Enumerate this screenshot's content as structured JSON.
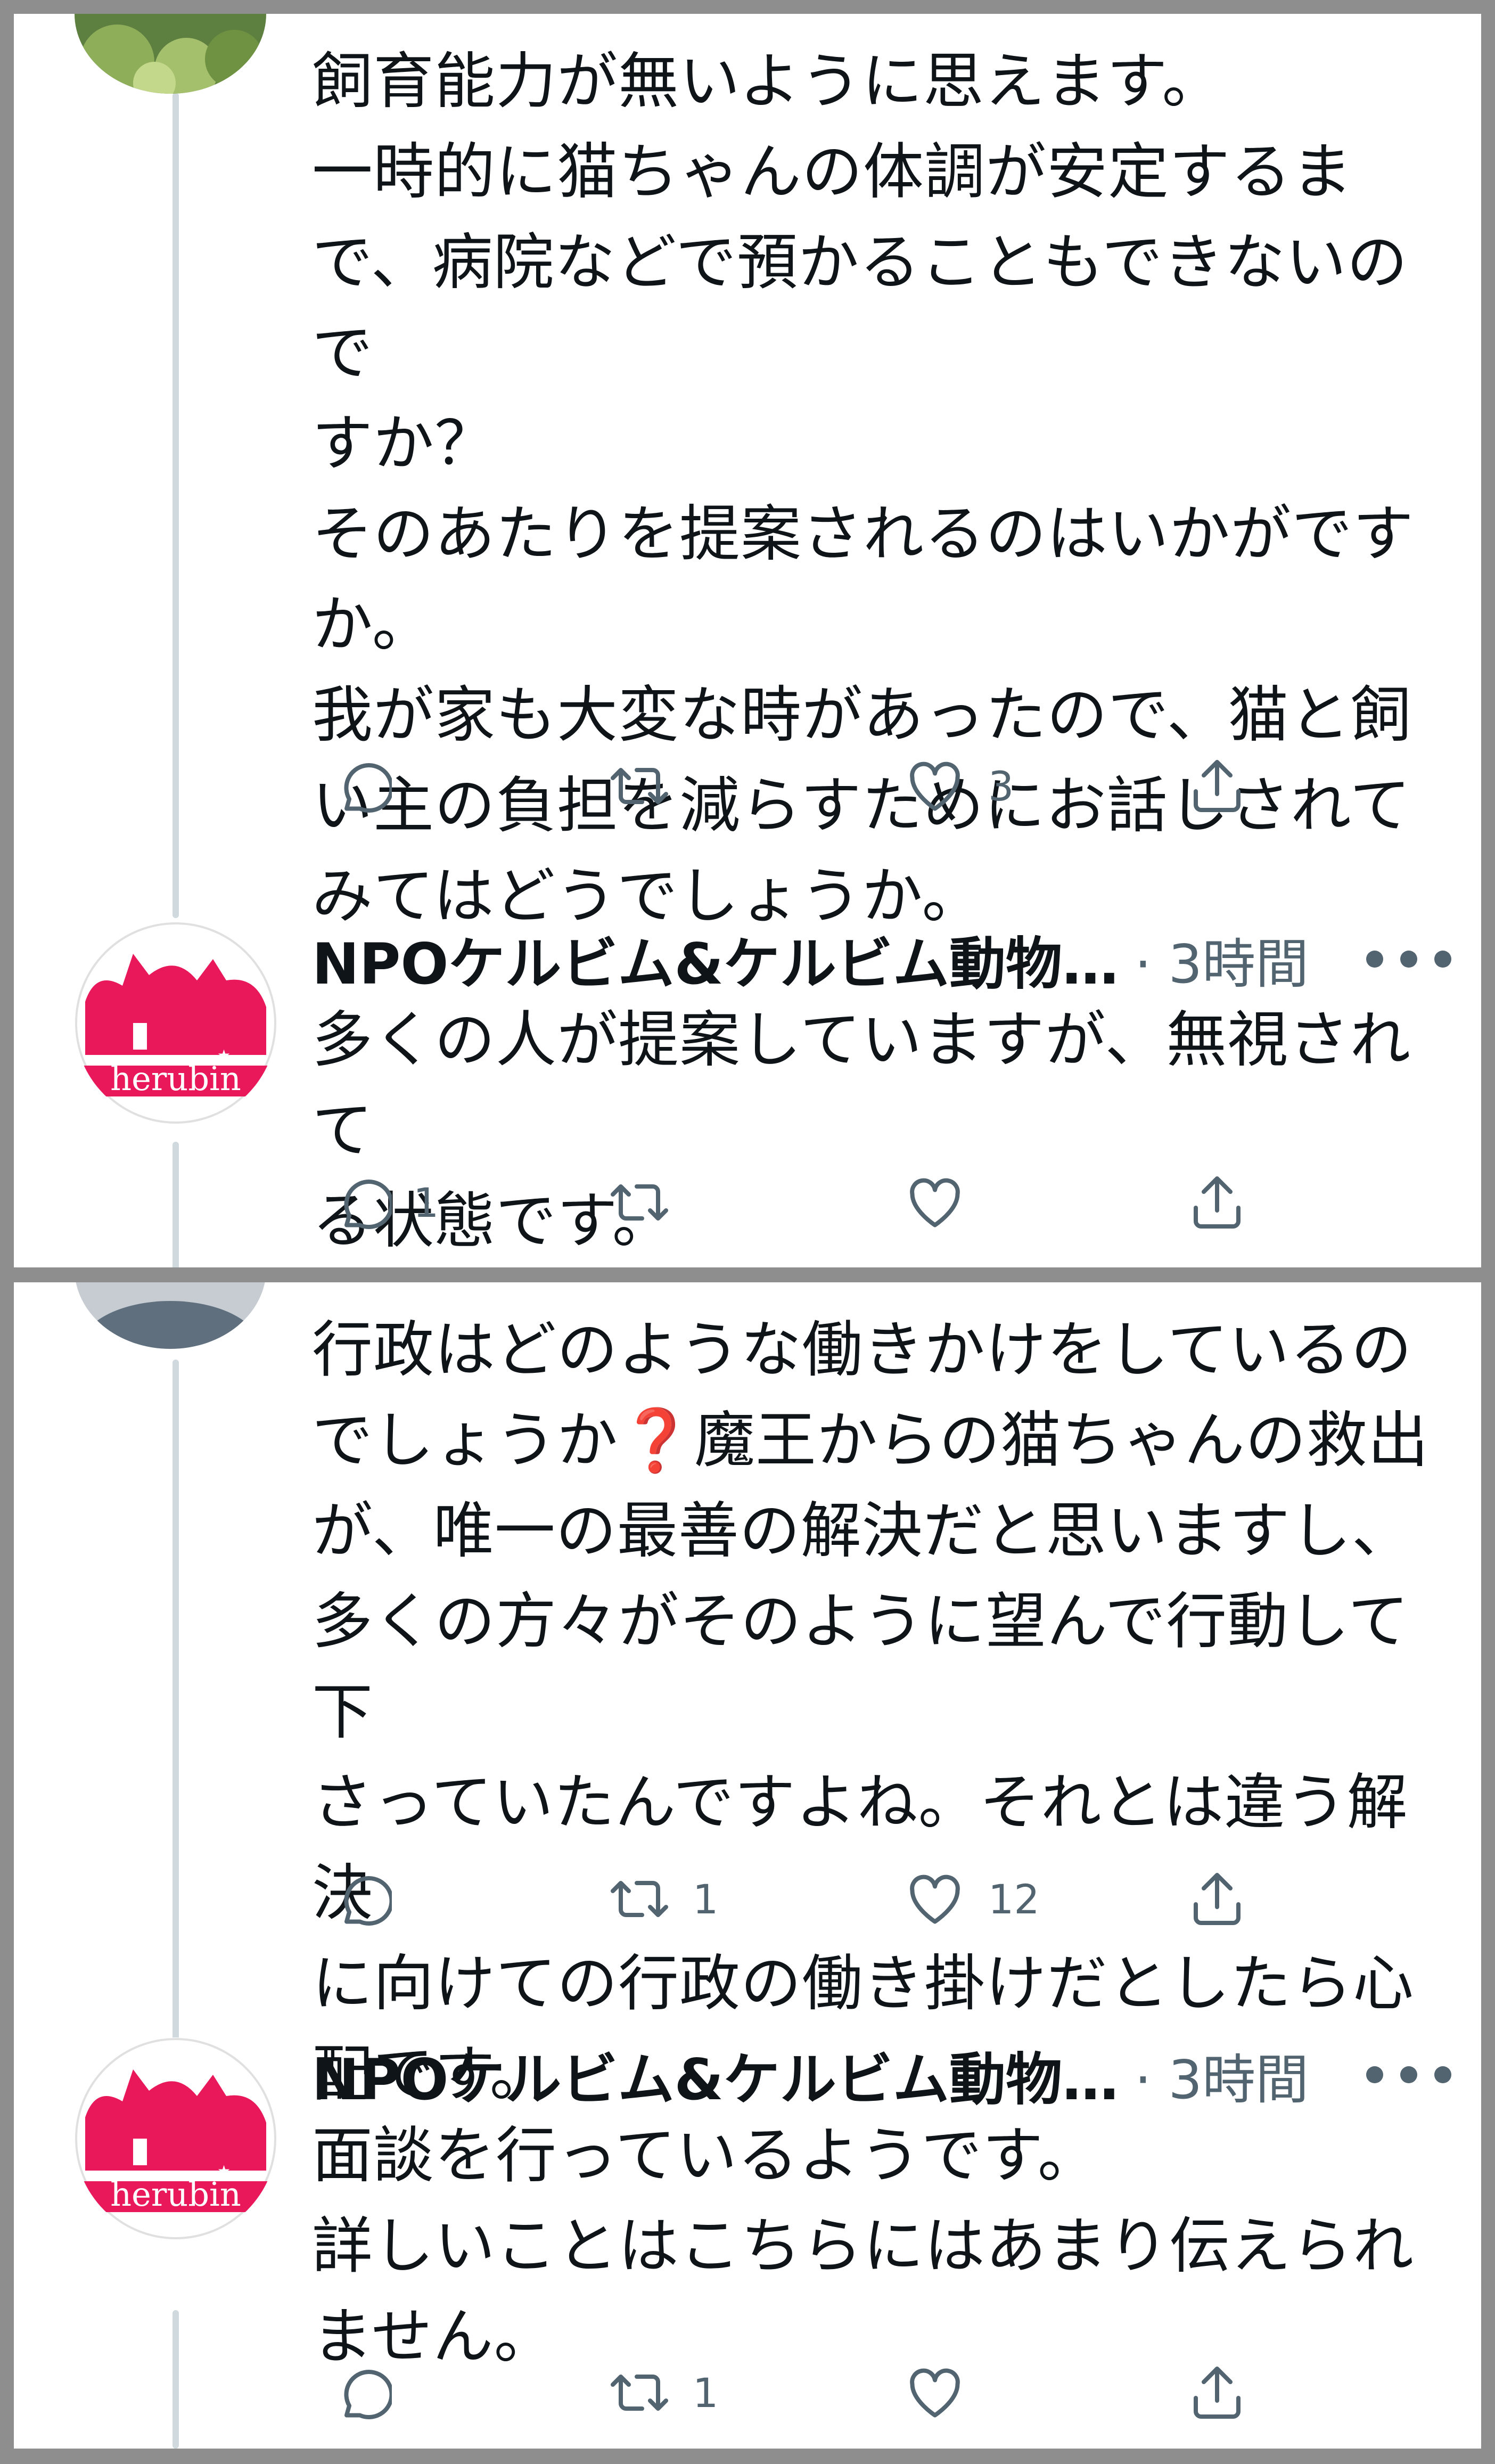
{
  "panel1": {
    "tweet_a": {
      "text": "飼育能力が無いように思えます。\n一時的に猫ちゃんの体調が安定するま\nで、病院などで預かることもできないので\nすか？\nそのあたりを提案されるのはいかがです\nか。\n我が家も大変な時があったので、猫と飼\nい主の負担を減らすためにお話しされて\nみてはどうでしょうか。",
      "reply_count": "",
      "retweet_count": "",
      "like_count": "3"
    },
    "tweet_b": {
      "author": "NPOケルビム&ケルビム動物…",
      "time": "· 3時間",
      "avatar_text": "herubin",
      "text": "多くの人が提案していますが、無視されて\nる状態です。",
      "reply_count": "1",
      "retweet_count": "",
      "like_count": ""
    }
  },
  "panel2": {
    "tweet_a": {
      "text": "行政はどのような働きかけをしているの\nでしょうか❓魔王からの猫ちゃんの救出\nが、唯一の最善の解決だと思いますし、\n多くの方々がそのように望んで行動して下\nさっていたんですよね。それとは違う解決\nに向けての行政の働き掛けだとしたら心\n配です。",
      "reply_count": "",
      "retweet_count": "1",
      "like_count": "12"
    },
    "tweet_b": {
      "author": "NPOケルビム&ケルビム動物…",
      "time": "· 3時間",
      "avatar_text": "herubin",
      "text": "面談を行っているようです。\n詳しいことはこちらにはあまり伝えられ\nません。",
      "reply_count": "",
      "retweet_count": "1",
      "like_count": ""
    }
  },
  "icons": [
    "reply-icon",
    "retweet-icon",
    "like-icon",
    "share-icon",
    "more-icon"
  ],
  "colors": {
    "accent_pink": "#e8185a",
    "icon_gray": "#536471",
    "thread_line": "#cfd9de",
    "frame": "#8e8e8e"
  }
}
